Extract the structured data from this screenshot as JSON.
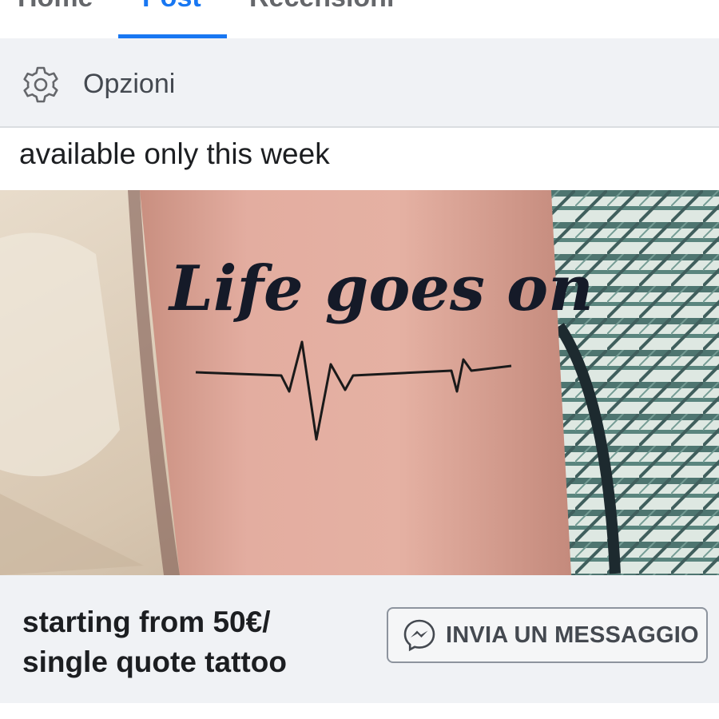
{
  "tabs": [
    {
      "label": "Home",
      "active": false
    },
    {
      "label": "Post",
      "active": true
    },
    {
      "label": "Recensioni",
      "active": false
    }
  ],
  "options": {
    "label": "Opzioni",
    "icon": "gear-icon"
  },
  "post": {
    "caption": "available only this week",
    "photo": {
      "tattoo_text": "Life goes on"
    }
  },
  "ad": {
    "offer_line1": "starting from 50€/",
    "offer_line2": "single quote tattoo",
    "cta_label": "INVIA UN MESSAGGIO",
    "cta_icon": "messenger-icon"
  },
  "colors": {
    "accent": "#1877f2",
    "panel": "#f0f2f5",
    "text": "#1c1e21"
  }
}
